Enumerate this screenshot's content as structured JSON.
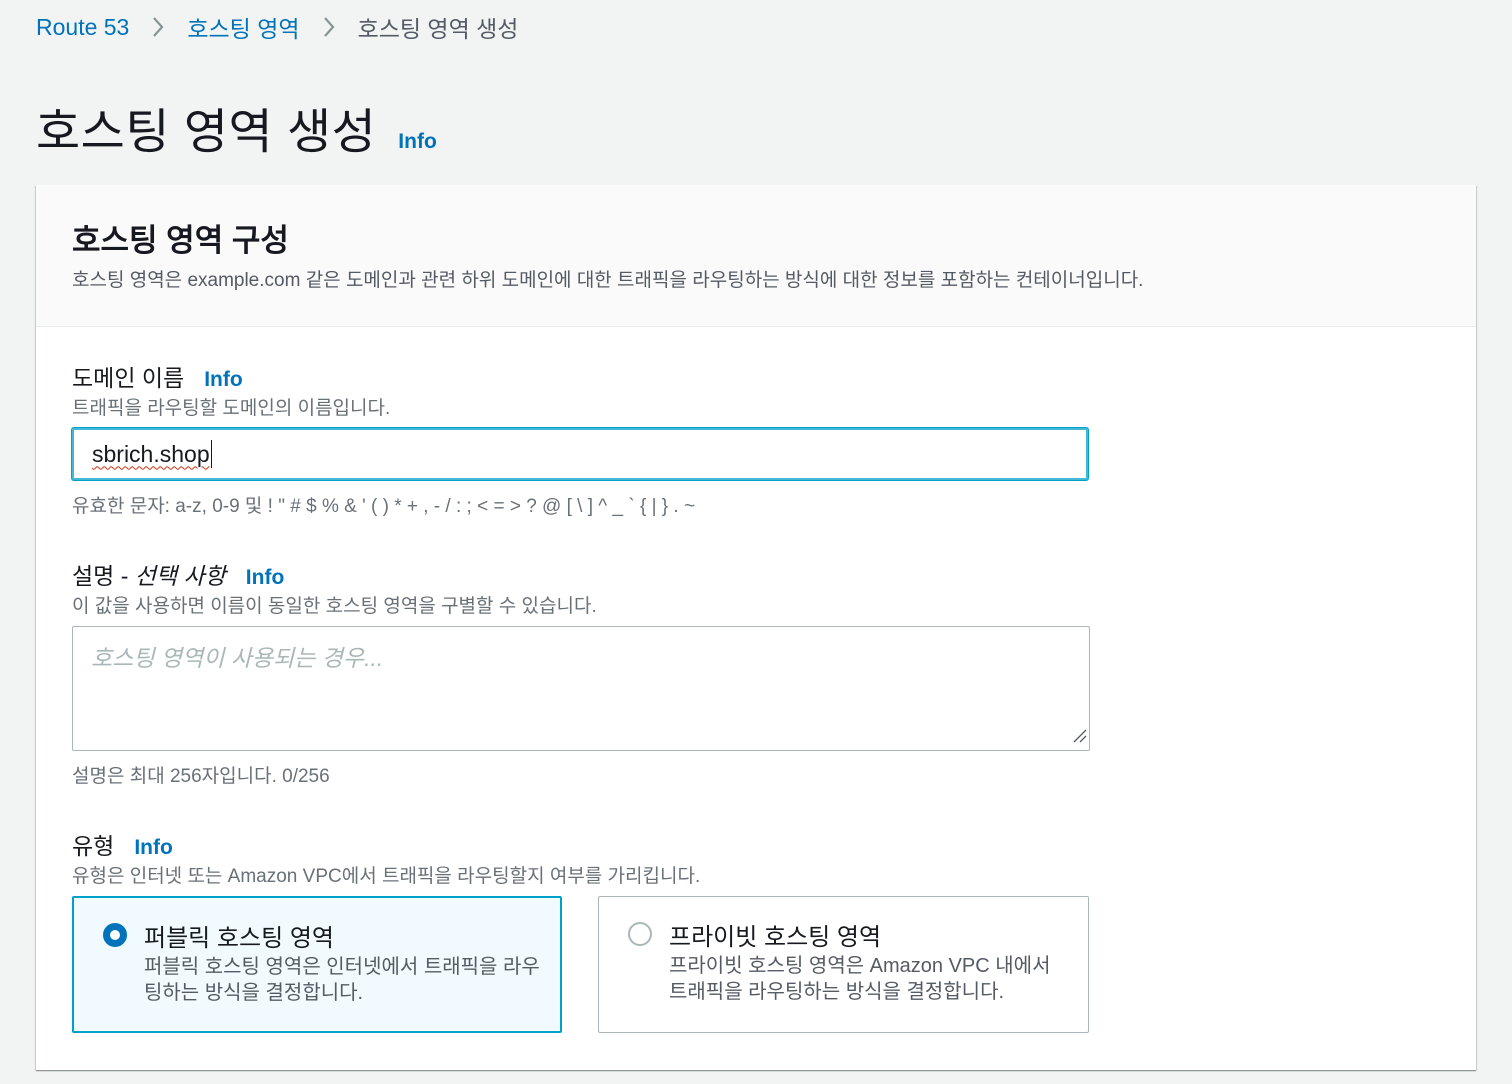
{
  "breadcrumb": {
    "items": [
      "Route 53",
      "호스팅 영역"
    ],
    "current": "호스팅 영역 생성"
  },
  "page": {
    "title": "호스팅 영역 생성",
    "info": "Info"
  },
  "panel": {
    "title": "호스팅 영역 구성",
    "description": "호스팅 영역은 example.com 같은 도메인과 관련 하위 도메인에 대한 트래픽을 라우팅하는 방식에 대한 정보를 포함하는 컨테이너입니다."
  },
  "domain_name": {
    "label": "도메인 이름",
    "info": "Info",
    "description": "트래픽을 라우팅할 도메인의 이름입니다.",
    "value": "sbrich.shop",
    "constraint": "유효한 문자: a-z, 0-9 및 ! \" # $ % & ' ( ) * + , - / : ; < = > ? @ [ \\ ] ^ _ ` { | } . ~"
  },
  "description_field": {
    "label": "설명 -",
    "label_optional": "선택 사항",
    "info": "Info",
    "description": "이 값을 사용하면 이름이 동일한 호스팅 영역을 구별할 수 있습니다.",
    "placeholder": "호스팅 영역이 사용되는 경우...",
    "value": "",
    "constraint": "설명은 최대 256자입니다. 0/256"
  },
  "type": {
    "label": "유형",
    "info": "Info",
    "description": "유형은 인터넷 또는 Amazon VPC에서 트래픽을 라우팅할지 여부를 가리킵니다.",
    "options": [
      {
        "label": "퍼블릭 호스팅 영역",
        "description": "퍼블릭 호스팅 영역은 인터넷에서 트래픽을 라우팅하는 방식을 결정합니다.",
        "selected": true
      },
      {
        "label": "프라이빗 호스팅 영역",
        "description": "프라이빗 호스팅 영역은 Amazon VPC 내에서 트래픽을 라우팅하는 방식을 결정합니다.",
        "selected": false
      }
    ]
  },
  "colors": {
    "link": "#0073bb",
    "focus": "#00a1c9",
    "selected_bg": "#f1faff",
    "page_bg": "#f2f3f3"
  },
  "icons": {
    "breadcrumb_separator": "chevron-right-icon",
    "resize": "resize-grip-icon"
  }
}
